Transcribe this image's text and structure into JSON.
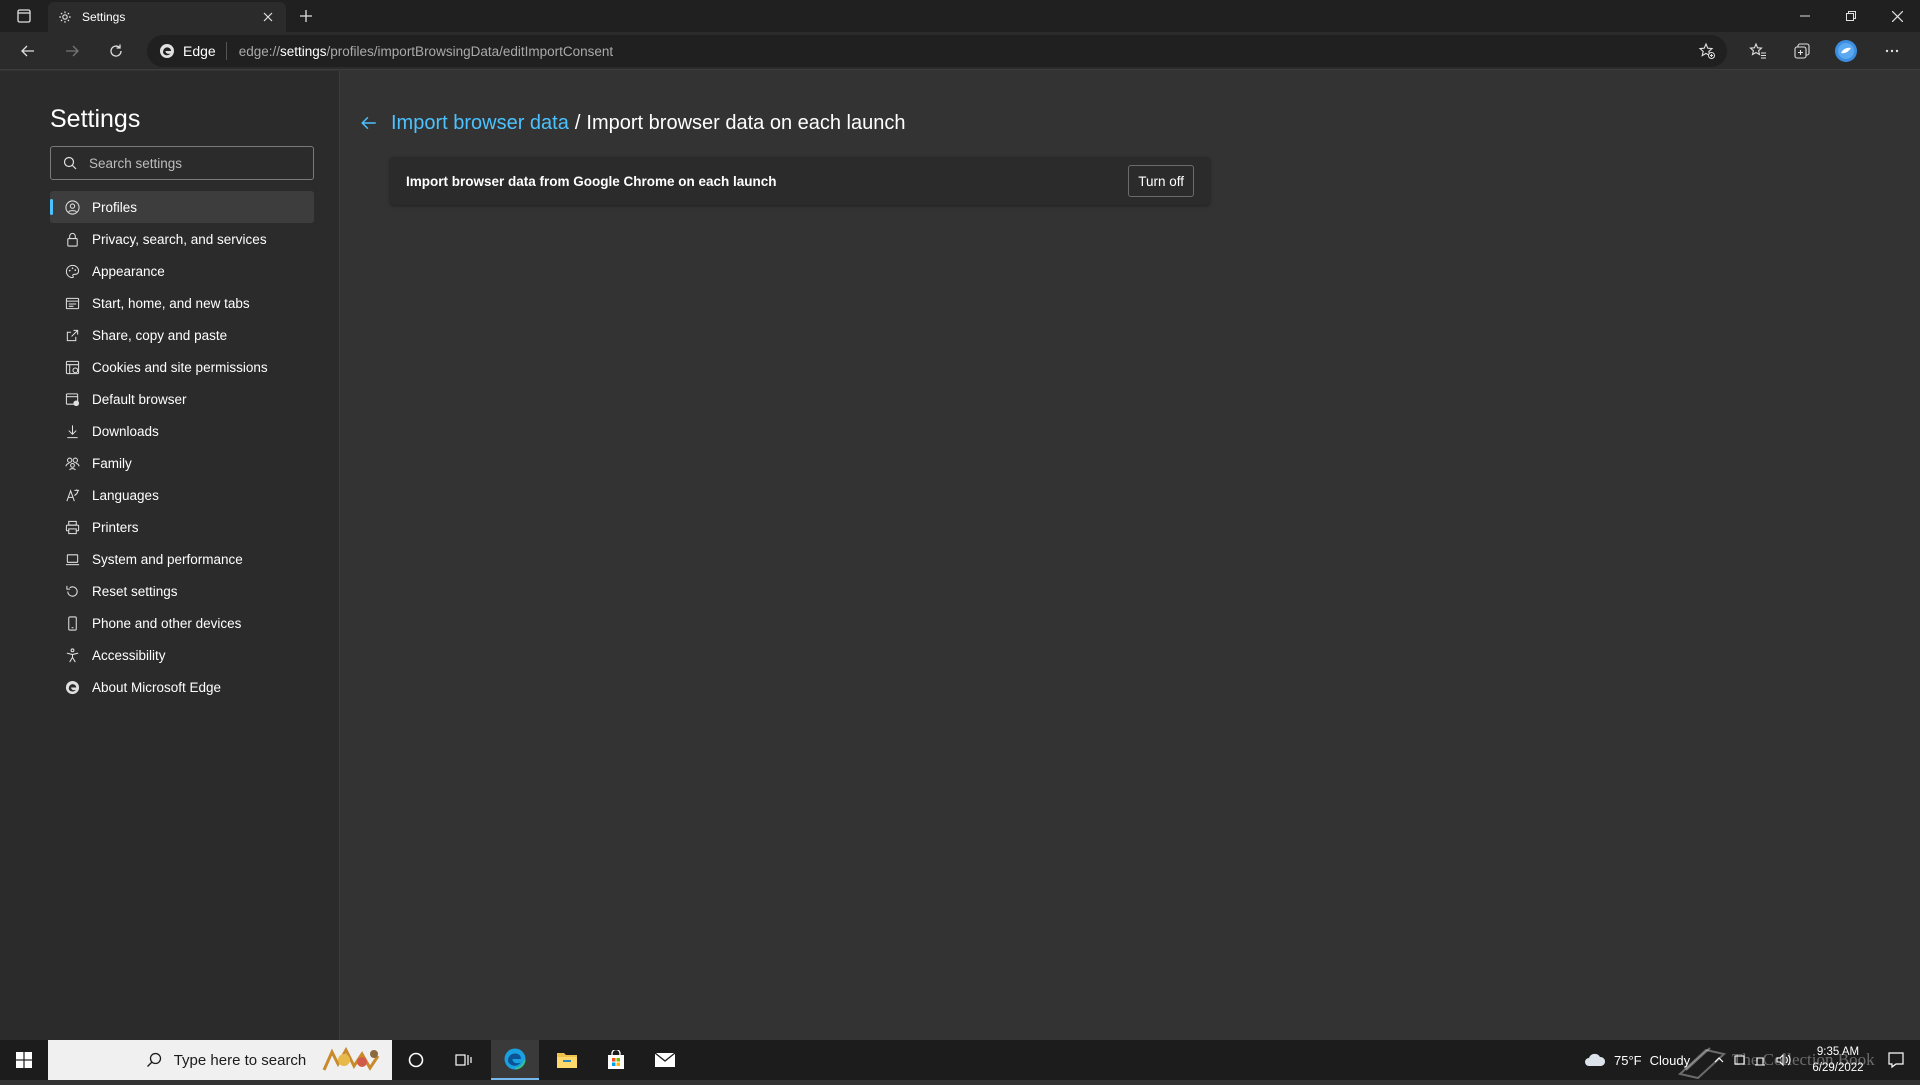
{
  "window": {
    "tab_title": "Settings",
    "colors": {
      "accent": "#4cc2ff",
      "background": "#333333",
      "sidebar": "#2b2b2b",
      "titlebar": "#202020"
    }
  },
  "addressbar": {
    "site_label": "Edge",
    "url_prefix": "edge://",
    "url_host": "settings",
    "url_path": "/profiles/importBrowsingData/editImportConsent"
  },
  "sidebar": {
    "title": "Settings",
    "search_placeholder": "Search settings",
    "items": [
      {
        "label": "Profiles",
        "icon": "profile-icon"
      },
      {
        "label": "Privacy, search, and services",
        "icon": "lock-icon"
      },
      {
        "label": "Appearance",
        "icon": "palette-icon"
      },
      {
        "label": "Start, home, and new tabs",
        "icon": "home-tabs-icon"
      },
      {
        "label": "Share, copy and paste",
        "icon": "share-icon"
      },
      {
        "label": "Cookies and site permissions",
        "icon": "cookies-icon"
      },
      {
        "label": "Default browser",
        "icon": "default-browser-icon"
      },
      {
        "label": "Downloads",
        "icon": "download-icon"
      },
      {
        "label": "Family",
        "icon": "family-icon"
      },
      {
        "label": "Languages",
        "icon": "languages-icon"
      },
      {
        "label": "Printers",
        "icon": "printer-icon"
      },
      {
        "label": "System and performance",
        "icon": "laptop-icon"
      },
      {
        "label": "Reset settings",
        "icon": "reset-icon"
      },
      {
        "label": "Phone and other devices",
        "icon": "phone-icon"
      },
      {
        "label": "Accessibility",
        "icon": "accessibility-icon"
      },
      {
        "label": "About Microsoft Edge",
        "icon": "edge-logo-icon"
      }
    ],
    "active_index": 0
  },
  "main": {
    "breadcrumb_link": "Import browser data",
    "breadcrumb_separator": "/",
    "breadcrumb_current": "Import browser data on each launch",
    "card_label": "Import browser data from Google Chrome on each launch",
    "card_button": "Turn off"
  },
  "taskbar": {
    "search_placeholder": "Type here to search",
    "weather_temp": "75°F",
    "weather_text": "Cloudy",
    "time": "9:35 AM",
    "date": "6/29/2022",
    "watermark": "The Collection Book"
  }
}
